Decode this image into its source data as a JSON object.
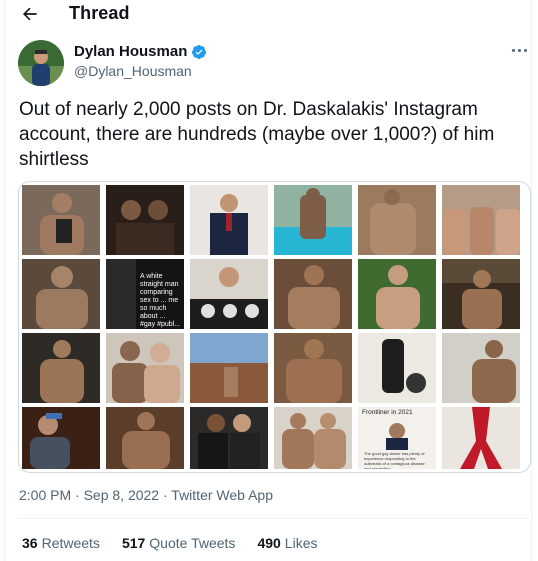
{
  "header": {
    "title": "Thread",
    "back_icon": "arrow-left-icon"
  },
  "author": {
    "name": "Dylan Housman",
    "handle": "@Dylan_Housman",
    "verified": true,
    "verified_color": "#1d9bf0"
  },
  "tweet": {
    "text": "Out of nearly 2,000 posts on Dr. Daskalakis' Instagram account, there are hundreds (maybe over 1,000?) of him shirtless",
    "time": "2:00 PM · Sep 8, 2022",
    "separator": " · ",
    "source": "Twitter Web App"
  },
  "media": {
    "tile_labels": {
      "r1c5": "A white straight man comparing sex to ... me so much about ... #gay #publ...",
      "r3c5": "Frontliner in 2021",
      "r3c5b": "The good gay doctor has plenty of experience responding to the outbreaks of a contagious disease and preventing"
    }
  },
  "stats": {
    "retweets_count": "36",
    "retweets_label": "Retweets",
    "quotes_count": "517",
    "quotes_label": "Quote Tweets",
    "likes_count": "490",
    "likes_label": "Likes"
  },
  "colors": {
    "text": "#0f1419",
    "secondary": "#536471",
    "border": "#cfd9de",
    "accent": "#1d9bf0"
  }
}
